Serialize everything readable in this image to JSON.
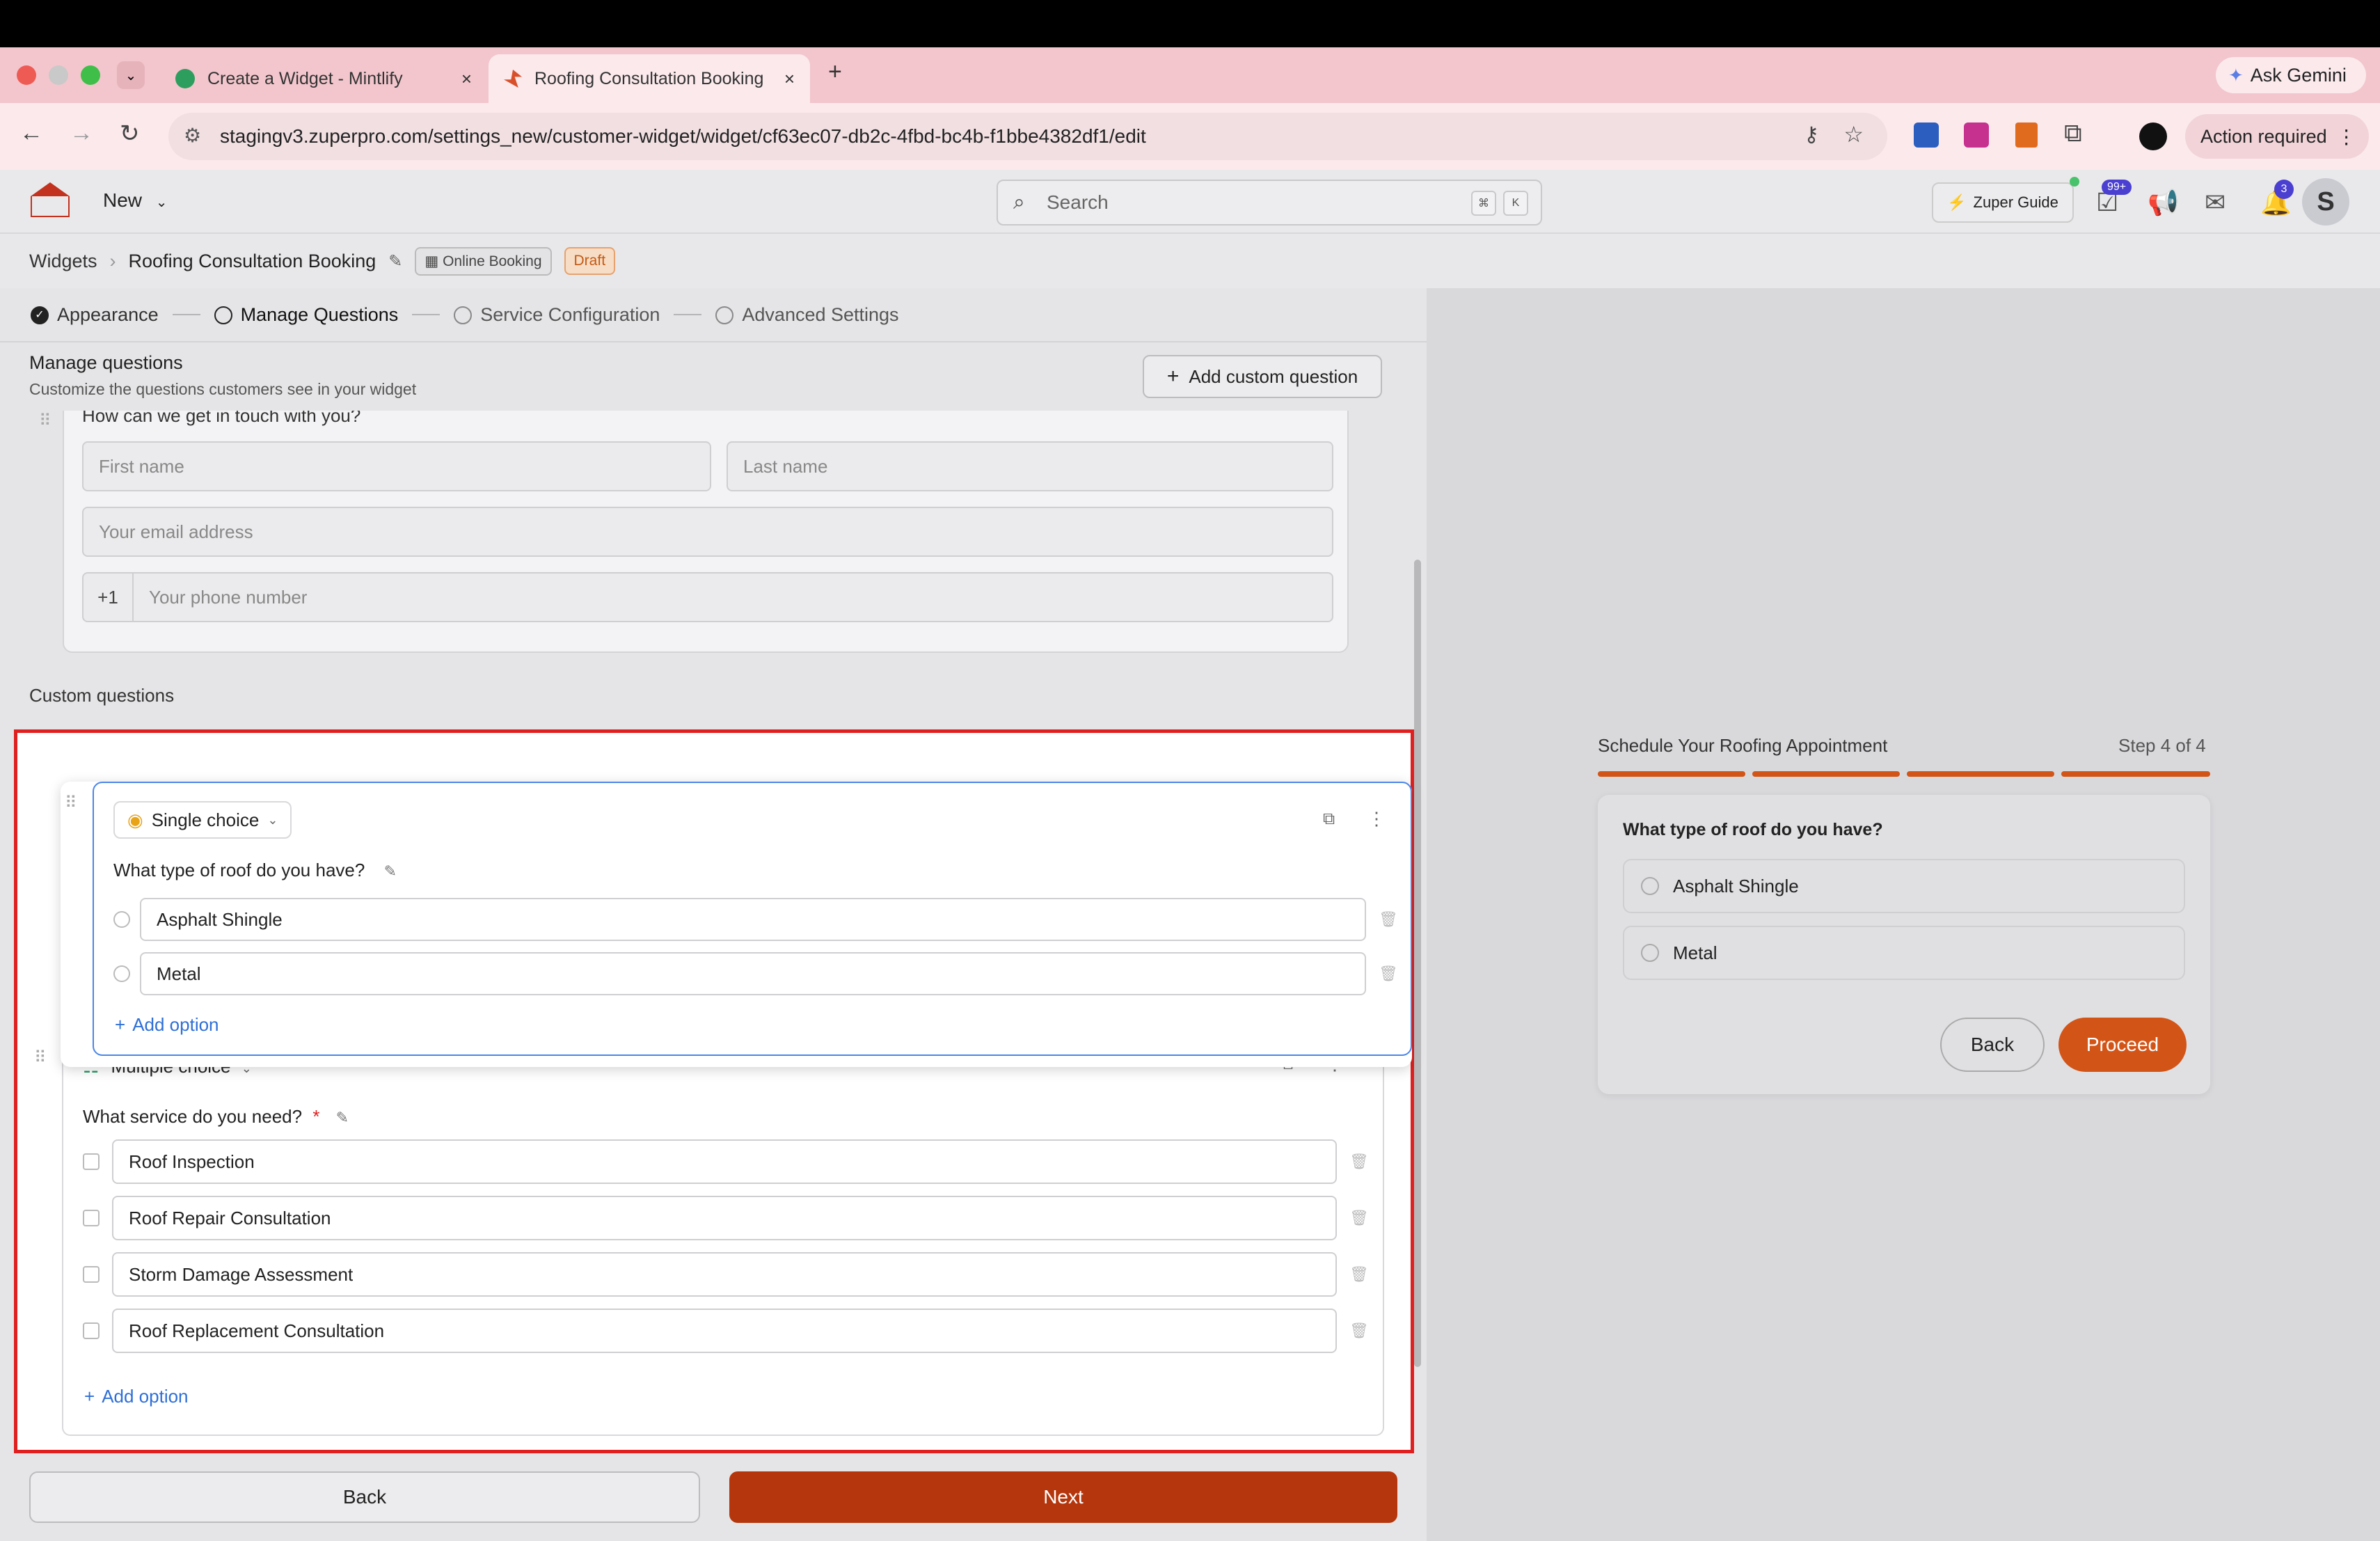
{
  "browser": {
    "tabs": [
      {
        "title": "Create a Widget - Mintlify",
        "close": "×"
      },
      {
        "title": "Roofing Consultation Booking",
        "close": "×"
      }
    ],
    "new_tab": "+",
    "url": "stagingv3.zuperpro.com/settings_new/customer-widget/widget/cf63ec07-db2c-4fbd-bc4b-f1bbe4382df1/edit",
    "ask_gemini": "Ask Gemini",
    "action_required": "Action required"
  },
  "header": {
    "new_label": "New",
    "search_placeholder": "Search",
    "kbd_cmd": "⌘",
    "kbd_k": "K",
    "zuper_guide": "Zuper Guide",
    "tasks_badge": "99+",
    "notif_badge": "3",
    "avatar": "S"
  },
  "breadcrumb": {
    "root": "Widgets",
    "current": "Roofing Consultation Booking",
    "type_badge": "Online Booking",
    "status_badge": "Draft"
  },
  "steps": [
    {
      "label": "Appearance"
    },
    {
      "label": "Manage Questions"
    },
    {
      "label": "Service Configuration"
    },
    {
      "label": "Advanced Settings"
    }
  ],
  "manage": {
    "title": "Manage questions",
    "subtitle": "Customize the questions customers see in your widget",
    "add_custom": "Add custom question"
  },
  "contact": {
    "question": "How can we get in touch with you?",
    "first_name": "First name",
    "last_name": "Last name",
    "email": "Your email address",
    "country_code": "+1",
    "phone": "Your phone number"
  },
  "custom_questions_label": "Custom questions",
  "single_choice": {
    "type_label": "Single choice",
    "question": "What type of roof do you have?",
    "options": [
      "Asphalt Shingle",
      "Metal"
    ],
    "add_option": "Add option"
  },
  "multiple_choice": {
    "type_label": "Multiple choice",
    "question": "What service do you need?",
    "required_mark": "*",
    "options": [
      "Roof Inspection",
      "Roof Repair Consultation",
      "Storm Damage Assessment",
      "Roof Replacement Consultation"
    ],
    "add_option": "Add option"
  },
  "footer": {
    "back": "Back",
    "next": "Next"
  },
  "preview": {
    "title": "Schedule Your Roofing Appointment",
    "step": "Step 4 of 4",
    "progress": 1.0,
    "question": "What type of roof do you have?",
    "options": [
      "Asphalt Shingle",
      "Metal"
    ],
    "back": "Back",
    "proceed": "Proceed"
  },
  "colors": {
    "accent": "#b5360c",
    "preview_accent": "#d35417",
    "highlight": "#e02020",
    "link": "#2f6fd6"
  }
}
